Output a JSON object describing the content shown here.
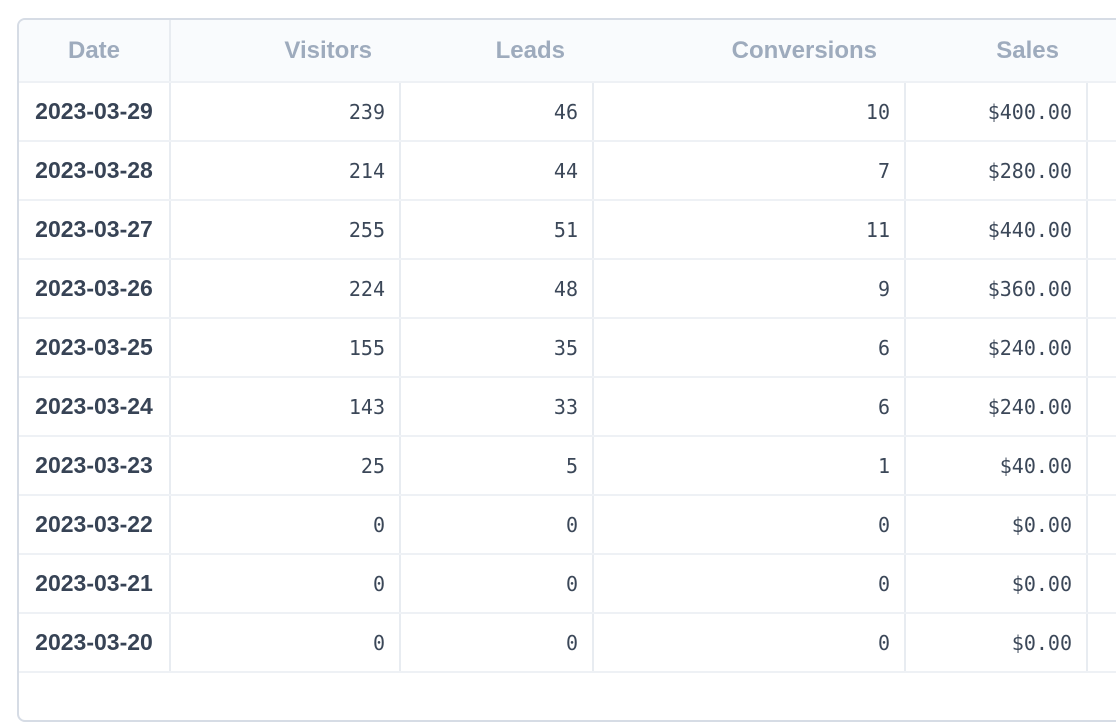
{
  "table": {
    "columns": [
      "Date",
      "Visitors",
      "Leads",
      "Conversions",
      "Sales"
    ],
    "rows": [
      {
        "date": "2023-03-29",
        "visitors": "239",
        "leads": "46",
        "conversions": "10",
        "sales": "$400.00"
      },
      {
        "date": "2023-03-28",
        "visitors": "214",
        "leads": "44",
        "conversions": "7",
        "sales": "$280.00"
      },
      {
        "date": "2023-03-27",
        "visitors": "255",
        "leads": "51",
        "conversions": "11",
        "sales": "$440.00"
      },
      {
        "date": "2023-03-26",
        "visitors": "224",
        "leads": "48",
        "conversions": "9",
        "sales": "$360.00"
      },
      {
        "date": "2023-03-25",
        "visitors": "155",
        "leads": "35",
        "conversions": "6",
        "sales": "$240.00"
      },
      {
        "date": "2023-03-24",
        "visitors": "143",
        "leads": "33",
        "conversions": "6",
        "sales": "$240.00"
      },
      {
        "date": "2023-03-23",
        "visitors": "25",
        "leads": "5",
        "conversions": "1",
        "sales": "$40.00"
      },
      {
        "date": "2023-03-22",
        "visitors": "0",
        "leads": "0",
        "conversions": "0",
        "sales": "$0.00"
      },
      {
        "date": "2023-03-21",
        "visitors": "0",
        "leads": "0",
        "conversions": "0",
        "sales": "$0.00"
      },
      {
        "date": "2023-03-20",
        "visitors": "0",
        "leads": "0",
        "conversions": "0",
        "sales": "$0.00"
      }
    ]
  },
  "colors": {
    "header_text": "#9eabbd",
    "cell_text": "#3b4758",
    "border": "#d6dce5"
  }
}
